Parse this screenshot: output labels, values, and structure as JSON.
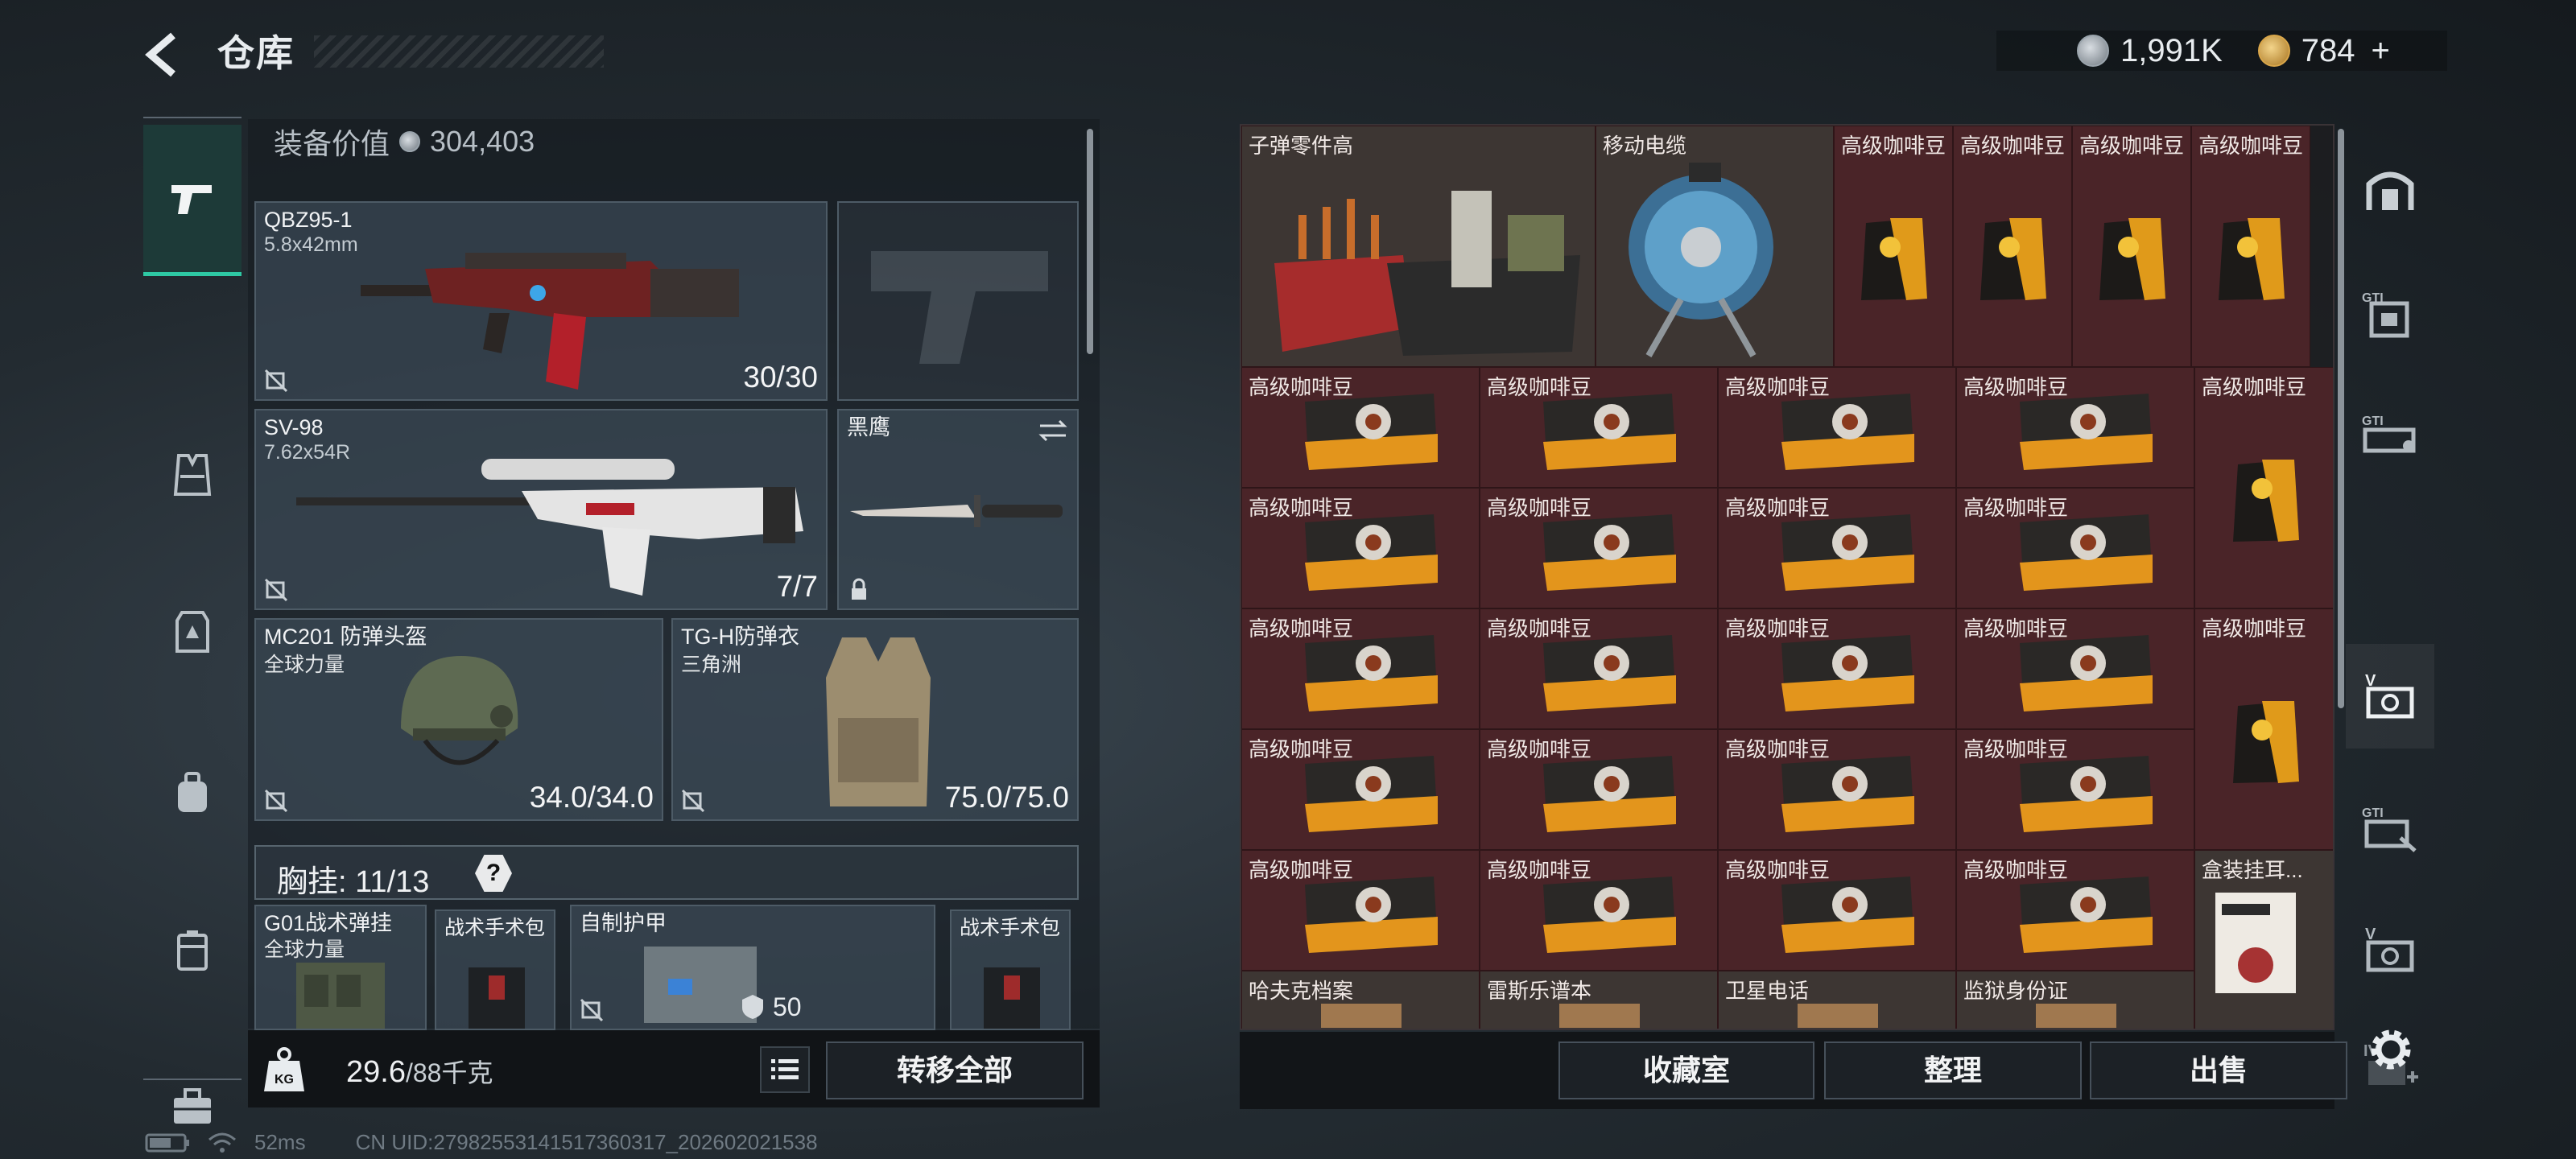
{
  "header": {
    "title": "仓库",
    "coins": "1,991K",
    "premium": "784",
    "premium_plus": "+"
  },
  "left_nav": {
    "items": [
      "pistol-icon",
      "vest-icon",
      "backpack-icon",
      "bag-icon",
      "case-icon",
      "toolbox-icon"
    ],
    "active": 0
  },
  "loadout": {
    "equipment_value_label": "装备价值",
    "equipment_value": "304,403",
    "slots": {
      "primary": {
        "name": "QBZ95-1",
        "sub": "5.8x42mm",
        "count": "30/30"
      },
      "secondary": {
        "name": "SV-98",
        "sub": "7.62x54R",
        "count": "7/7"
      },
      "melee": {
        "name": "黑鹰"
      },
      "helmet": {
        "name": "MC201 防弹头盔",
        "sub": "全球力量",
        "count": "34.0/34.0"
      },
      "armor": {
        "name": "TG-H防弹衣",
        "sub": "三角洲",
        "count": "75.0/75.0"
      }
    },
    "chest_label": "胸挂: 11/13",
    "chest_help": "?",
    "gear_row": [
      {
        "name": "G01战术弹挂",
        "sub": "全球力量"
      },
      {
        "name": "战术手术包"
      },
      {
        "name": "自制护甲",
        "count": "50"
      },
      {
        "name": "战术手术包"
      }
    ],
    "weight": "29.6",
    "weight_max": "/88千克",
    "transfer_all": "转移全部"
  },
  "status": {
    "ping": "52ms",
    "uid": "CN UID:27982553141517360317_202602021538"
  },
  "stash": {
    "top_row": [
      {
        "name": "子弹零件高",
        "kind": "parts"
      },
      {
        "name": "移动电缆",
        "kind": "cable"
      },
      {
        "name": "高级咖啡豆",
        "kind": "coffee-bag"
      },
      {
        "name": "高级咖啡豆",
        "kind": "coffee-bag"
      },
      {
        "name": "高级咖啡豆",
        "kind": "coffee-bag"
      },
      {
        "name": "高级咖啡豆",
        "kind": "coffee-bag"
      }
    ],
    "coffee_box_label": "高级咖啡豆",
    "coffee_tall_label": "高级咖啡豆",
    "earphone_label": "盒装挂耳...",
    "bottom_row": [
      "哈夫克档案",
      "雷斯乐谱本",
      "卫星电话",
      "监狱身份证"
    ],
    "buttons": {
      "collection": "收藏室",
      "sort": "整理",
      "sell": "出售"
    }
  },
  "right_nav": {
    "items": [
      "shelter-icon",
      "gti-case-icon",
      "gti-tray-icon",
      "v-case-icon",
      "gti-pouch-icon",
      "v-box-icon",
      "iv-box-add-icon"
    ],
    "active": 3
  },
  "colors": {
    "accent": "#2ec9a4",
    "stash_cell": "#4a2428"
  }
}
